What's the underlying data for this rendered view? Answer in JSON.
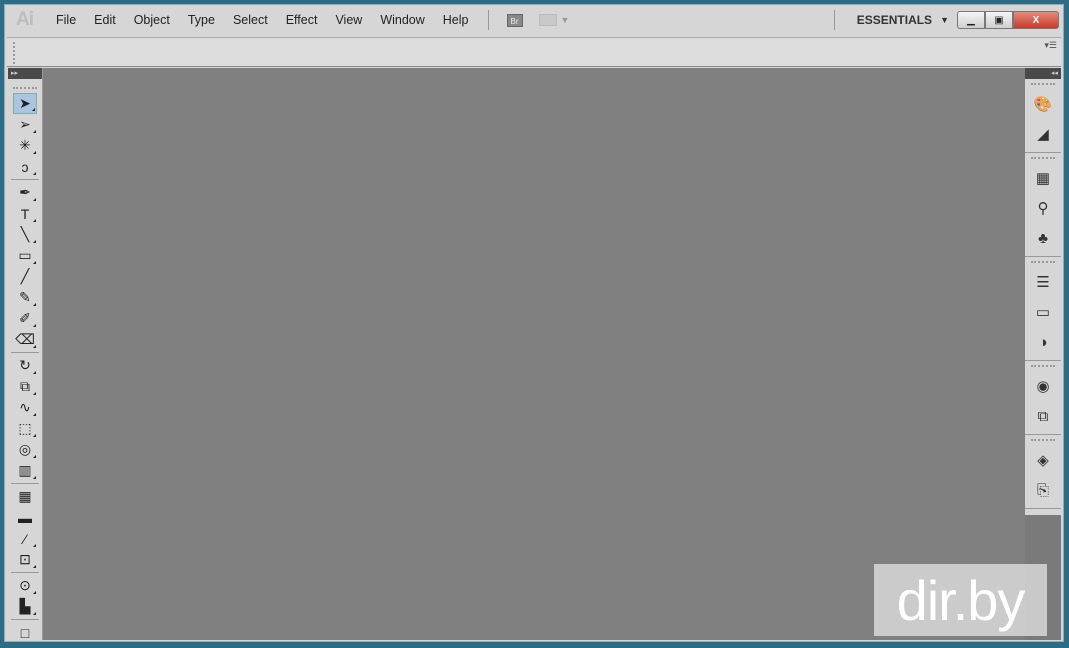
{
  "app": {
    "logo": "Ai",
    "bridge": "Br"
  },
  "menu": [
    "File",
    "Edit",
    "Object",
    "Type",
    "Select",
    "Effect",
    "View",
    "Window",
    "Help"
  ],
  "workspace": {
    "label": "ESSENTIALS",
    "dropdown": "▼"
  },
  "window_controls": {
    "minimize": "▁",
    "maximize": "▣",
    "close": "X"
  },
  "panel_menu": "▾☰",
  "toolbar": {
    "collapse": "▸▸",
    "tools": [
      {
        "name": "selection-tool",
        "glyph": "➤"
      },
      {
        "name": "direct-selection-tool",
        "glyph": "➢"
      },
      {
        "name": "magic-wand-tool",
        "glyph": "✳"
      },
      {
        "name": "lasso-tool",
        "glyph": "ↄ"
      },
      {
        "sep": true
      },
      {
        "name": "pen-tool",
        "glyph": "✒"
      },
      {
        "name": "type-tool",
        "glyph": "T"
      },
      {
        "name": "line-segment-tool",
        "glyph": "╲"
      },
      {
        "name": "rectangle-tool",
        "glyph": "▭"
      },
      {
        "name": "paintbrush-tool",
        "glyph": "╱"
      },
      {
        "name": "pencil-tool",
        "glyph": "✎"
      },
      {
        "name": "blob-brush-tool",
        "glyph": "✐"
      },
      {
        "name": "eraser-tool",
        "glyph": "⌫"
      },
      {
        "sep": true
      },
      {
        "name": "rotate-tool",
        "glyph": "↻"
      },
      {
        "name": "scale-tool",
        "glyph": "⧉"
      },
      {
        "name": "warp-tool",
        "glyph": "∿"
      },
      {
        "name": "free-transform-tool",
        "glyph": "⬚"
      },
      {
        "name": "shape-builder-tool",
        "glyph": "◎"
      },
      {
        "name": "perspective-grid-tool",
        "glyph": "▥"
      },
      {
        "sep": true
      },
      {
        "name": "mesh-tool",
        "glyph": "▦"
      },
      {
        "name": "gradient-tool",
        "glyph": "▬"
      },
      {
        "name": "eyedropper-tool",
        "glyph": "⁄"
      },
      {
        "name": "blend-tool",
        "glyph": "⊡"
      },
      {
        "sep": true
      },
      {
        "name": "symbol-sprayer-tool",
        "glyph": "⊙"
      },
      {
        "name": "column-graph-tool",
        "glyph": "▙"
      },
      {
        "sep": true
      },
      {
        "name": "artboard-tool",
        "glyph": "□"
      }
    ]
  },
  "right_panel": {
    "collapse": "◂◂",
    "groups": [
      [
        {
          "name": "color-icon",
          "glyph": "🎨"
        },
        {
          "name": "color-guide-icon",
          "glyph": "◢"
        }
      ],
      [
        {
          "name": "swatches-icon",
          "glyph": "▦"
        },
        {
          "name": "brushes-icon",
          "glyph": "⚲"
        },
        {
          "name": "symbols-icon",
          "glyph": "♣"
        }
      ],
      [
        {
          "name": "stroke-icon",
          "glyph": "☰"
        },
        {
          "name": "gradient-icon",
          "glyph": "▭"
        },
        {
          "name": "transparency-icon",
          "glyph": "◑"
        }
      ],
      [
        {
          "name": "appearance-icon",
          "glyph": "◉"
        },
        {
          "name": "graphic-styles-icon",
          "glyph": "⧉"
        }
      ],
      [
        {
          "name": "layers-icon",
          "glyph": "◈"
        },
        {
          "name": "artboards-icon",
          "glyph": "⎘"
        }
      ]
    ]
  },
  "watermark": "dir.by"
}
